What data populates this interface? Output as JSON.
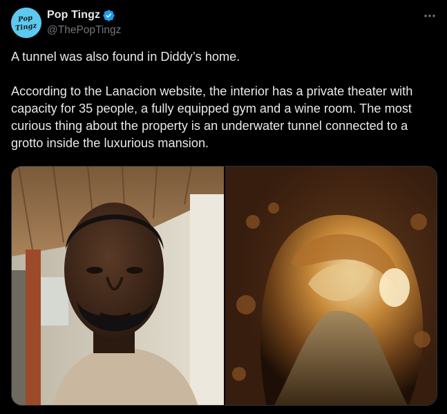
{
  "author": {
    "display_name": "Pop Tingz",
    "handle": "@ThePopTingz",
    "avatar_text": "Pop Tingz",
    "verified": true
  },
  "icons": {
    "verified": "verified-badge-icon",
    "more": "more-options-icon"
  },
  "post": {
    "paragraphs": [
      "A tunnel was also found in Diddy’s home.",
      "According to the Lanacion website, the interior has a private theater with capacity for 35 people, a fully equipped gym and a wine room. The most curious thing about the property is an underwater tunnel connected to a grotto inside the luxurious mansion."
    ]
  },
  "media": {
    "images": [
      {
        "subject": "selfie-of-man-in-house"
      },
      {
        "subject": "lit-rocky-cave-tunnel"
      }
    ]
  },
  "colors": {
    "background": "#000000",
    "text": "#e7e9ea",
    "secondary_text": "#71767b",
    "verified_blue": "#1d9bf0",
    "avatar_bg": "#5cc9ef",
    "border": "#2f3336"
  }
}
